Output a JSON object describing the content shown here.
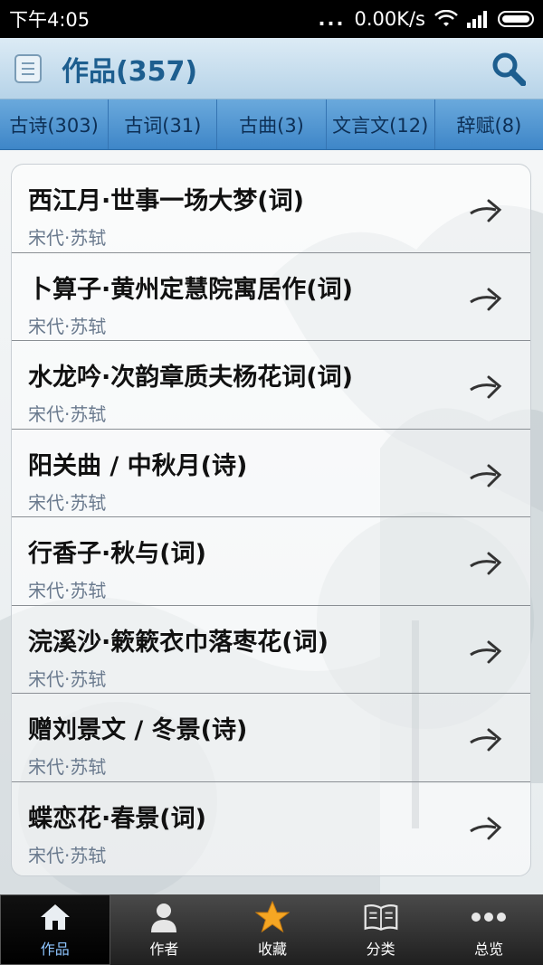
{
  "status_bar": {
    "time": "下午4:05",
    "dots": "...",
    "speed": "0.00K/s"
  },
  "header": {
    "title": "作品(357)"
  },
  "tabs": [
    {
      "label": "古诗(303)"
    },
    {
      "label": "古词(31)"
    },
    {
      "label": "古曲(3)"
    },
    {
      "label": "文言文(12)"
    },
    {
      "label": "辞赋(8)"
    }
  ],
  "works": [
    {
      "title": "西江月·世事一场大梦(词)",
      "author": "宋代·苏轼"
    },
    {
      "title": "卜算子·黄州定慧院寓居作(词)",
      "author": "宋代·苏轼"
    },
    {
      "title": "水龙吟·次韵章质夫杨花词(词)",
      "author": "宋代·苏轼"
    },
    {
      "title": "阳关曲 / 中秋月(诗)",
      "author": "宋代·苏轼"
    },
    {
      "title": "行香子·秋与(词)",
      "author": "宋代·苏轼"
    },
    {
      "title": "浣溪沙·簌簌衣巾落枣花(词)",
      "author": "宋代·苏轼"
    },
    {
      "title": "赠刘景文 / 冬景(诗)",
      "author": "宋代·苏轼"
    },
    {
      "title": "蝶恋花·春景(词)",
      "author": "宋代·苏轼"
    }
  ],
  "bottom_nav": [
    {
      "label": "作品",
      "icon": "home-icon"
    },
    {
      "label": "作者",
      "icon": "person-icon"
    },
    {
      "label": "收藏",
      "icon": "star-icon"
    },
    {
      "label": "分类",
      "icon": "book-icon"
    },
    {
      "label": "总览",
      "icon": "more-icon"
    }
  ],
  "colors": {
    "accent": "#3e86c8",
    "title": "#1d5e8f",
    "star": "#f5a623"
  }
}
